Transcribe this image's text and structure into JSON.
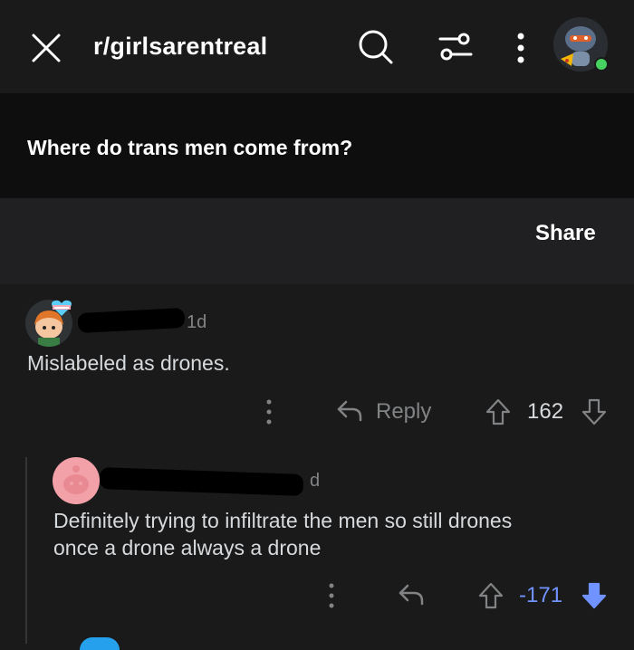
{
  "header": {
    "subreddit": "r/girlsarentreal",
    "icons": [
      "close-icon",
      "search-icon",
      "filter-icon",
      "more-icon",
      "user-avatar"
    ]
  },
  "post": {
    "title": "Where do trans men come from?",
    "share_label": "Share"
  },
  "comments": [
    {
      "age": "1d",
      "text": "Mislabeled as drones.",
      "reply_label": "Reply",
      "score": "162",
      "vote": "none"
    },
    {
      "age": "d",
      "text_lines": [
        "Definitely trying to infiltrate the men so still drones",
        "once a drone always a drone"
      ],
      "score": "-171",
      "vote": "down"
    }
  ],
  "colors": {
    "background": "#1a1a1b",
    "post_band": "#0e0e0f",
    "share_band": "#202022",
    "text": "#d7dadc",
    "muted": "#818384",
    "downvote": "#7193ff",
    "online": "#46d160"
  }
}
